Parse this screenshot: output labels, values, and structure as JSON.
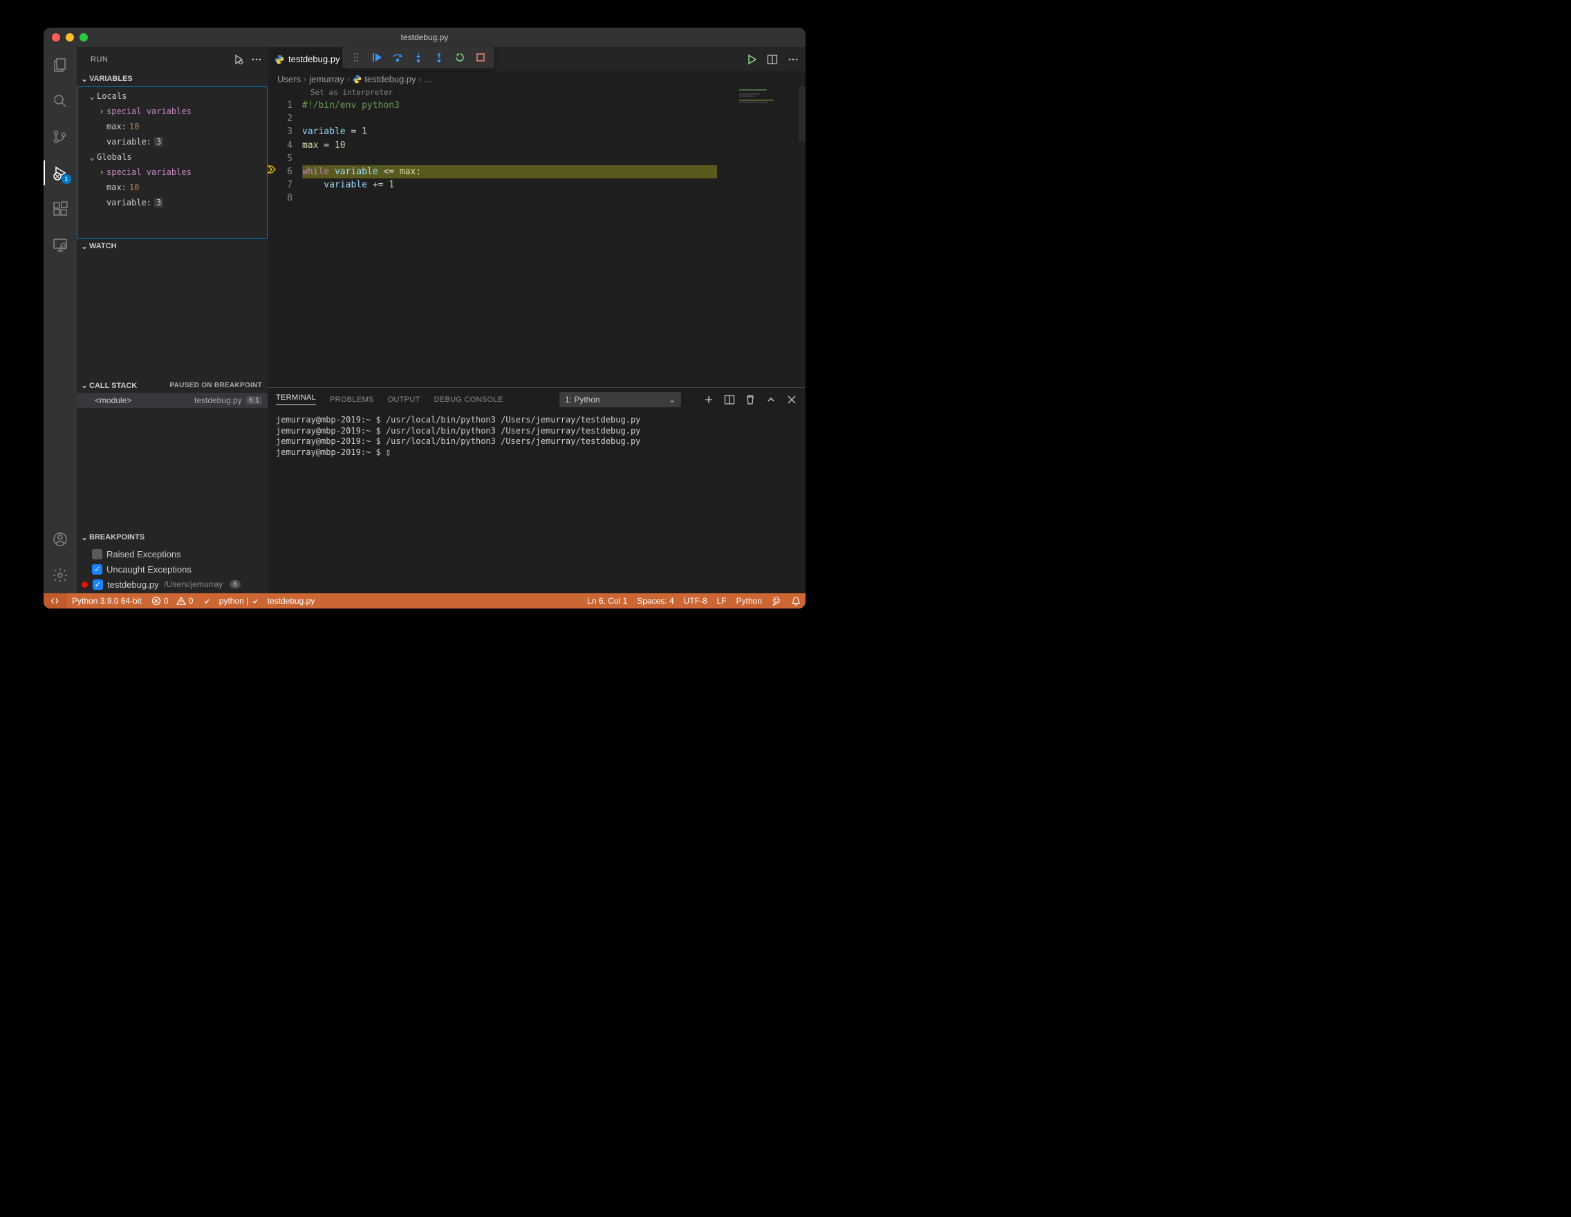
{
  "window": {
    "title": "testdebug.py"
  },
  "activity": {
    "run_badge": "1"
  },
  "sidebar": {
    "title": "RUN",
    "sections": {
      "variables": {
        "label": "VARIABLES",
        "locals_label": "Locals",
        "globals_label": "Globals",
        "special_label": "special variables",
        "vars": {
          "max_name": "max:",
          "max_val": "10",
          "variable_name": "variable:",
          "variable_val": "3"
        }
      },
      "watch": {
        "label": "WATCH"
      },
      "callstack": {
        "label": "CALL STACK",
        "status": "PAUSED ON BREAKPOINT",
        "frame": {
          "name": "<module>",
          "file": "testdebug.py",
          "pos": "6:1"
        }
      },
      "breakpoints": {
        "label": "BREAKPOINTS",
        "raised": "Raised Exceptions",
        "uncaught": "Uncaught Exceptions",
        "file_bp": {
          "file": "testdebug.py",
          "path": "/Users/jemurray",
          "count": "6"
        }
      }
    }
  },
  "tabs": {
    "file": "testdebug.py"
  },
  "breadcrumb": {
    "p0": "Users",
    "p1": "jemurray",
    "p2": "testdebug.py",
    "p3": "..."
  },
  "codelens": "Set as interpreter",
  "code": {
    "lines": [
      "1",
      "2",
      "3",
      "4",
      "5",
      "6",
      "7",
      "8"
    ],
    "l1": "#!/bin/env python3",
    "l3_a": "variable",
    "l3_b": " = ",
    "l3_c": "1",
    "l4_a": "max",
    "l4_b": " = ",
    "l4_c": "10",
    "l6_a": "while",
    "l6_b": " variable ",
    "l6_c": "<=",
    "l6_d": " max",
    "l6_e": ":",
    "l7_a": "    variable ",
    "l7_b": "+=",
    "l7_c": " ",
    "l7_d": "1"
  },
  "panel": {
    "tabs": {
      "terminal": "TERMINAL",
      "problems": "PROBLEMS",
      "output": "OUTPUT",
      "debug": "DEBUG CONSOLE"
    },
    "terminal_select": "1: Python",
    "lines": [
      "jemurray@mbp-2019:~ $ /usr/local/bin/python3 /Users/jemurray/testdebug.py",
      "jemurray@mbp-2019:~ $ /usr/local/bin/python3 /Users/jemurray/testdebug.py",
      "jemurray@mbp-2019:~ $ /usr/local/bin/python3 /Users/jemurray/testdebug.py",
      "jemurray@mbp-2019:~ $ ▯"
    ]
  },
  "status": {
    "interpreter": "Python 3.9.0 64-bit",
    "errors": "0",
    "warnings": "0",
    "debug_target": "python | ",
    "debug_file": "testdebug.py",
    "cursor": "Ln 6, Col 1",
    "spaces": "Spaces: 4",
    "encoding": "UTF-8",
    "eol": "LF",
    "lang": "Python"
  }
}
